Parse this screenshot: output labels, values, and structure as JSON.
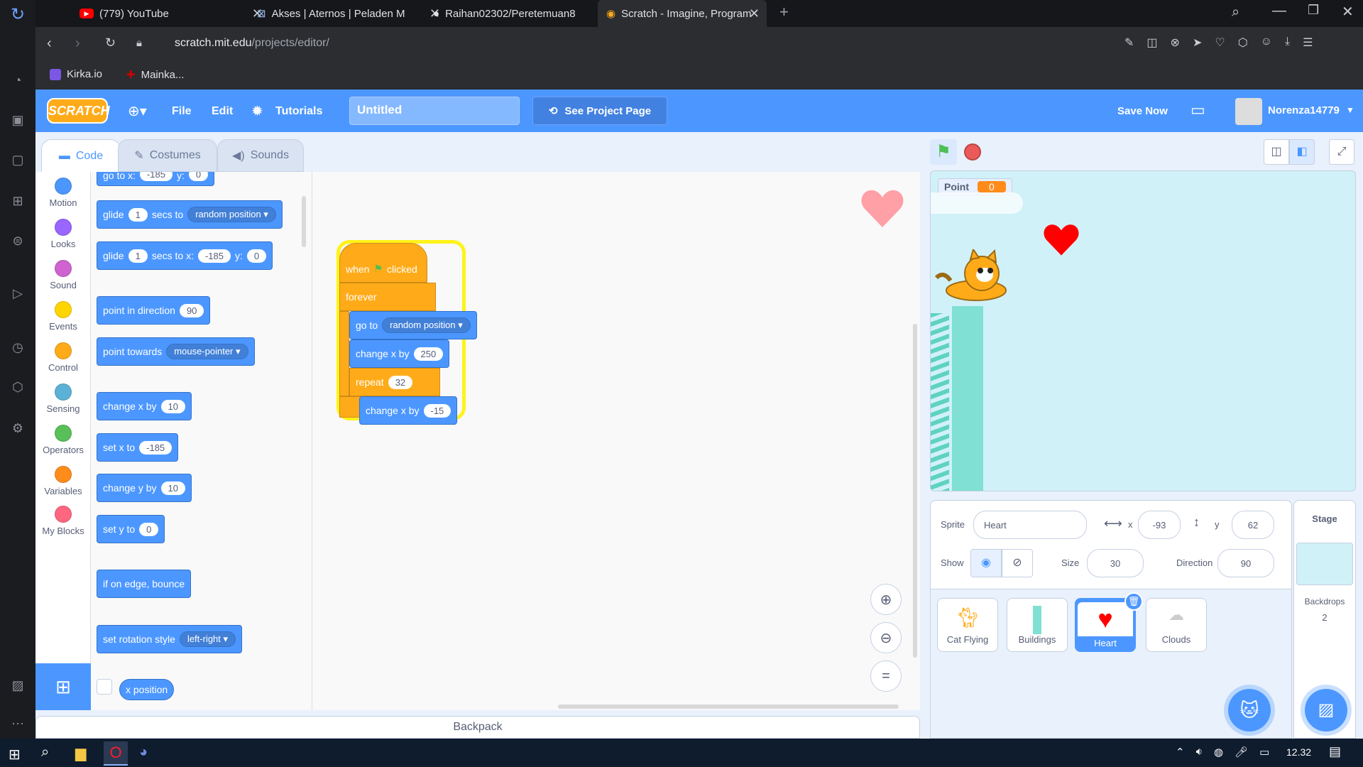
{
  "browser": {
    "tabs": [
      {
        "title": "(779) YouTube",
        "icon": "youtube-icon"
      },
      {
        "title": "Akses | Aternos | Peladen M",
        "icon": "aternos-icon"
      },
      {
        "title": "Raihan02302/Peretemuan8",
        "icon": "github-icon"
      },
      {
        "title": "Scratch - Imagine, Program",
        "icon": "scratch-icon"
      }
    ],
    "url_host": "scratch.mit.edu",
    "url_path": "/projects/editor/",
    "bookmarks": [
      "Kirka.io",
      "Mainka..."
    ]
  },
  "menu": {
    "logo": "SCRATCH",
    "file": "File",
    "edit": "Edit",
    "tutorials": "Tutorials",
    "project_title": "Untitled",
    "see_project": "See Project Page",
    "save_now": "Save Now",
    "username": "Norenza14779"
  },
  "editor_tabs": {
    "code": "Code",
    "costumes": "Costumes",
    "sounds": "Sounds"
  },
  "categories": [
    {
      "label": "Motion",
      "color": "#4c97ff"
    },
    {
      "label": "Looks",
      "color": "#9966ff"
    },
    {
      "label": "Sound",
      "color": "#cf63cf"
    },
    {
      "label": "Events",
      "color": "#ffd500"
    },
    {
      "label": "Control",
      "color": "#ffab19"
    },
    {
      "label": "Sensing",
      "color": "#5cb1d6"
    },
    {
      "label": "Operators",
      "color": "#59c059"
    },
    {
      "label": "Variables",
      "color": "#ff8c1a"
    },
    {
      "label": "My Blocks",
      "color": "#ff6680"
    }
  ],
  "palette": {
    "goto_xy": {
      "a": "go to x:",
      "x": "-185",
      "b": "y:",
      "y": "0"
    },
    "glide_random": {
      "a": "glide",
      "n": "1",
      "b": "secs to",
      "drop": "random position"
    },
    "glide_xy": {
      "a": "glide",
      "n": "1",
      "b": "secs to x:",
      "x": "-185",
      "c": "y:",
      "y": "0"
    },
    "point_dir": {
      "a": "point in direction",
      "v": "90"
    },
    "point_towards": {
      "a": "point towards",
      "drop": "mouse-pointer"
    },
    "change_x": {
      "a": "change x by",
      "v": "10"
    },
    "set_x": {
      "a": "set x to",
      "v": "-185"
    },
    "change_y": {
      "a": "change y by",
      "v": "10"
    },
    "set_y": {
      "a": "set y to",
      "v": "0"
    },
    "bounce": "if on edge, bounce",
    "rotation": {
      "a": "set rotation style",
      "drop": "left-right"
    },
    "xpos": "x position"
  },
  "script": {
    "when": "when",
    "clicked": "clicked",
    "forever": "forever",
    "goto": "go to",
    "goto_drop": "random position",
    "change_x": "change x by",
    "change_x_val": "250",
    "repeat": "repeat",
    "repeat_val": "32",
    "inner_change": "change x by",
    "inner_val": "-15"
  },
  "backpack": "Backpack",
  "stage": {
    "monitor_label": "Point",
    "monitor_value": "0"
  },
  "sprite_info": {
    "sprite_label": "Sprite",
    "sprite_name": "Heart",
    "x_label": "x",
    "x": "-93",
    "y_label": "y",
    "y": "62",
    "show_label": "Show",
    "size_label": "Size",
    "size": "30",
    "direction_label": "Direction",
    "direction": "90"
  },
  "sprites": [
    "Cat Flying",
    "Buildings",
    "Heart",
    "Clouds"
  ],
  "stage_panel": {
    "title": "Stage",
    "backdrops_label": "Backdrops",
    "backdrops_count": "2"
  },
  "taskbar": {
    "time": "12.32"
  }
}
